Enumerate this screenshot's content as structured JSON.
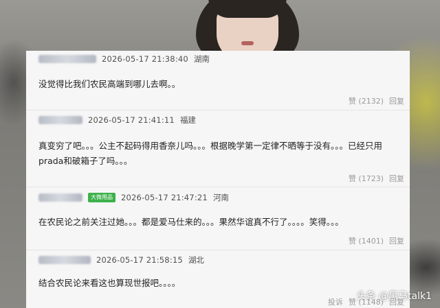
{
  "comments": [
    {
      "timestamp": "2026-05-17 21:38:40",
      "location": "湖南",
      "text": "没觉得比我们农民高端到哪儿去啊。。",
      "like_label": "赞",
      "like_count": "(2132)",
      "reply_label": "回复"
    },
    {
      "timestamp": "2026-05-17 21:41:11",
      "location": "福建",
      "text": "真变穷了吧。。。公主不起码得用香奈儿吗。。。根据晚学第一定律不晒等于没有。。。已经只用prada和破箱子了吗。。。",
      "like_label": "赞",
      "like_count": "(1723)",
      "reply_label": "回复"
    },
    {
      "badge": "大微用品",
      "timestamp": "2026-05-17 21:47:21",
      "location": "河南",
      "text": "在农民论之前关注过她。。。都是爱马仕来的。。。果然华谊真不行了。。。。笑得。。。",
      "like_label": "赞",
      "like_count": "(1401)",
      "reply_label": "回复"
    },
    {
      "timestamp": "2026-05-17 21:58:15",
      "location": "湖北",
      "text": "结合农民论来看这也算现世报吧。。。。",
      "report_label": "投诉",
      "like_label": "赞",
      "like_count": "(1148)",
      "reply_label": "回复"
    }
  ],
  "watermark": "头条 @黑马talk1"
}
